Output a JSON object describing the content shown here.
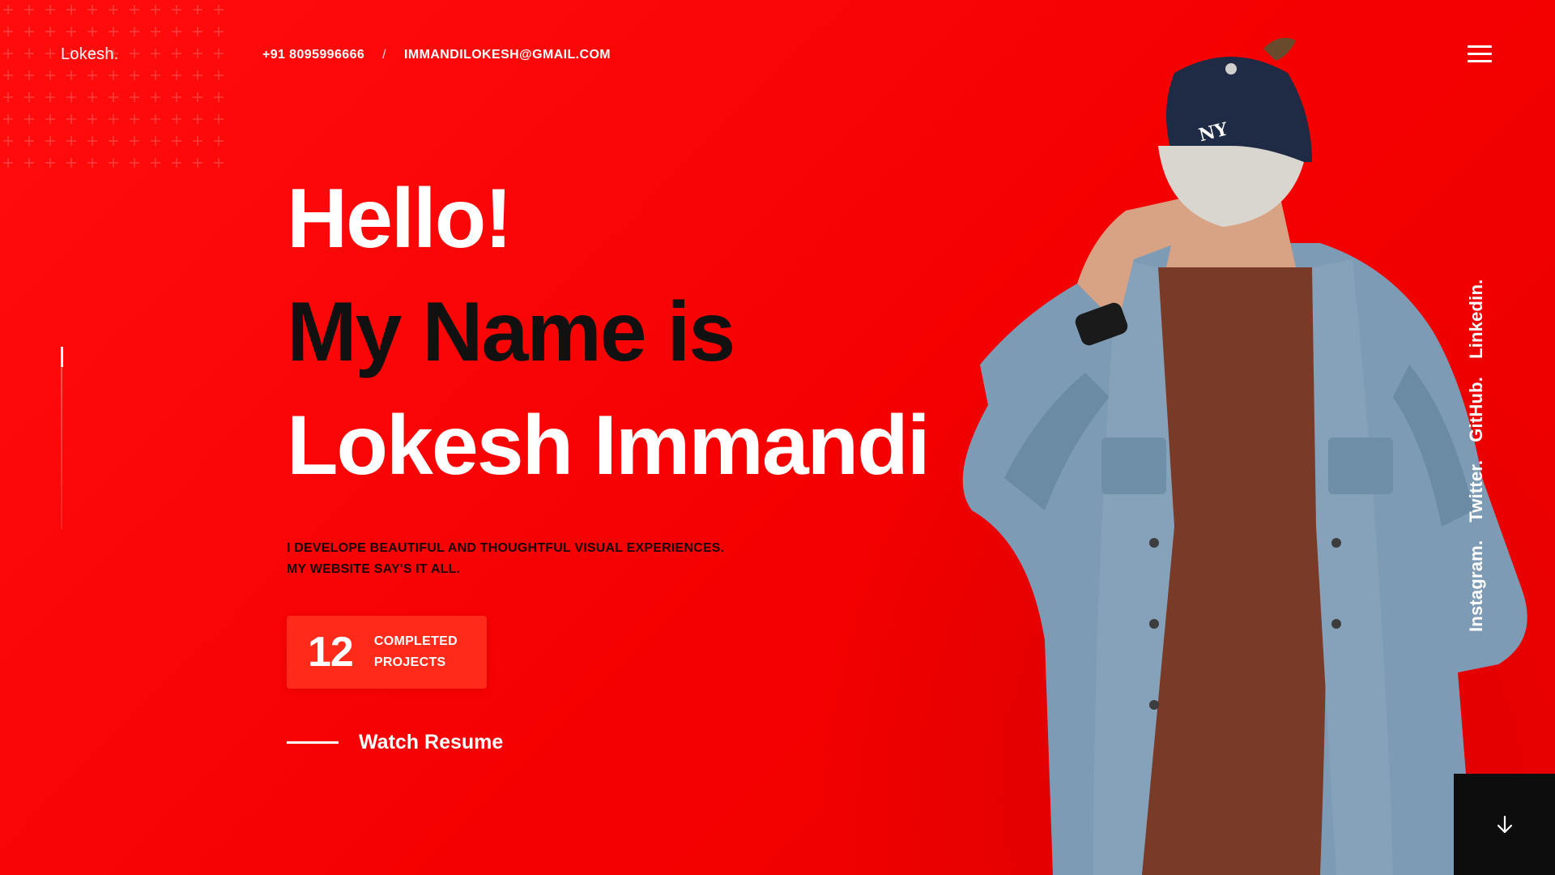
{
  "header": {
    "logo": "Lokesh.",
    "phone": "+91 8095996666",
    "separator": "/",
    "email": "IMMANDILOKESH@GMAIL.COM",
    "menu_icon": "hamburger-menu-icon"
  },
  "hero": {
    "line1": "Hello!",
    "line2": "My Name is",
    "line3": "Lokesh Immandi",
    "tagline_line1": "I DEVELOPE BEAUTIFUL AND THOUGHTFUL VISUAL EXPERIENCES.",
    "tagline_line2": "MY WEBSITE SAY'S IT ALL.",
    "stats": {
      "number": "12",
      "label_line1": "COMPLETED",
      "label_line2": "PROJECTS"
    },
    "watch_resume": "Watch Resume"
  },
  "socials": [
    "Instagram.",
    "Twitter.",
    "GitHub.",
    "Linkedin."
  ],
  "scroll_button_icon": "arrow-down-icon",
  "colors": {
    "background": "#ff0000",
    "accent_dark": "#111111",
    "stats_box": "#ff2a1a",
    "scroll_button": "#0d0d0d"
  }
}
